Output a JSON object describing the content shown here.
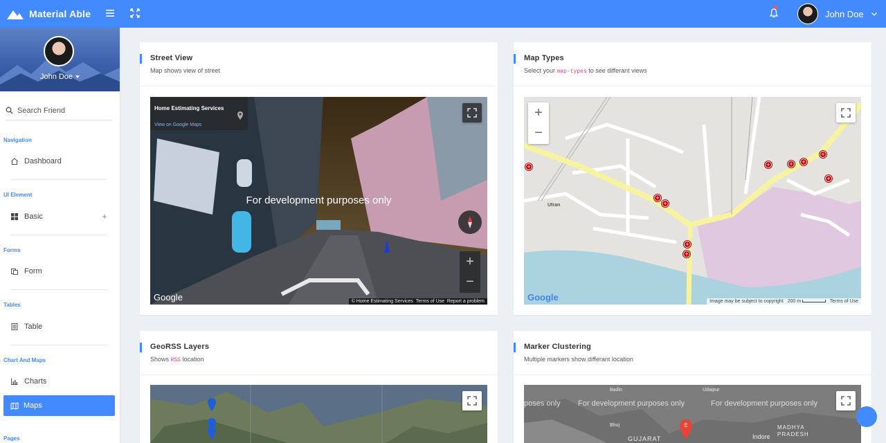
{
  "app": {
    "brand_name": "Material Able",
    "user_name": "John Doe"
  },
  "colors": {
    "primary": "#448aff",
    "background": "#ecf0f5",
    "marker": "#cc0000"
  },
  "sidebar": {
    "profile_name": "John Doe",
    "search_placeholder": "Search Friend",
    "sections": [
      {
        "caption": "Navigation",
        "item": "Dashboard",
        "icon": "home-icon"
      },
      {
        "caption": "UI Element",
        "item": "Basic",
        "icon": "grid-icon"
      },
      {
        "caption": "Forms",
        "item": "Form",
        "icon": "form-icon"
      },
      {
        "caption": "Tables",
        "item": "Table",
        "icon": "table-icon"
      },
      {
        "caption": "Chart And Maps",
        "item": "Charts",
        "icon": "chart-icon"
      }
    ],
    "active_item": "Maps",
    "last_caption": "Pages"
  },
  "cards": {
    "street_view": {
      "title": "Street View",
      "subtitle": "Map shows view of street",
      "overlay_place": "Home Estimating Services",
      "overlay_link": "View on Google Maps",
      "dev_text": "For development purposes only",
      "attribution": "© Home Estimating Services",
      "terms": "Terms of Use",
      "report": "Report a problem",
      "google": "Google"
    },
    "map_types": {
      "title": "Map Types",
      "subtitle_pre": "Select your",
      "subtitle_code": "map-types",
      "subtitle_post": "to see differant views",
      "place_label": "Utran",
      "copyright": "Image may be subject to copyright",
      "scale": "200 m",
      "terms": "Terms of Use",
      "google": "Google"
    },
    "georss": {
      "title": "GeoRSS Layers",
      "subtitle_pre": "Shows",
      "subtitle_code": "RSS",
      "subtitle_post": "location"
    },
    "marker_clustering": {
      "title": "Marker Clustering",
      "subtitle": "Multiple markers show differant location",
      "dev_text_1": "poses only",
      "dev_text_2": "For development purposes only",
      "dev_text_3": "For development purposes only",
      "places": [
        "Badin",
        "Udaipur",
        "Bhuj",
        "GUJARAT",
        "Indore",
        "MADHYA",
        "PRADESH"
      ],
      "marker_letter": "E"
    }
  }
}
